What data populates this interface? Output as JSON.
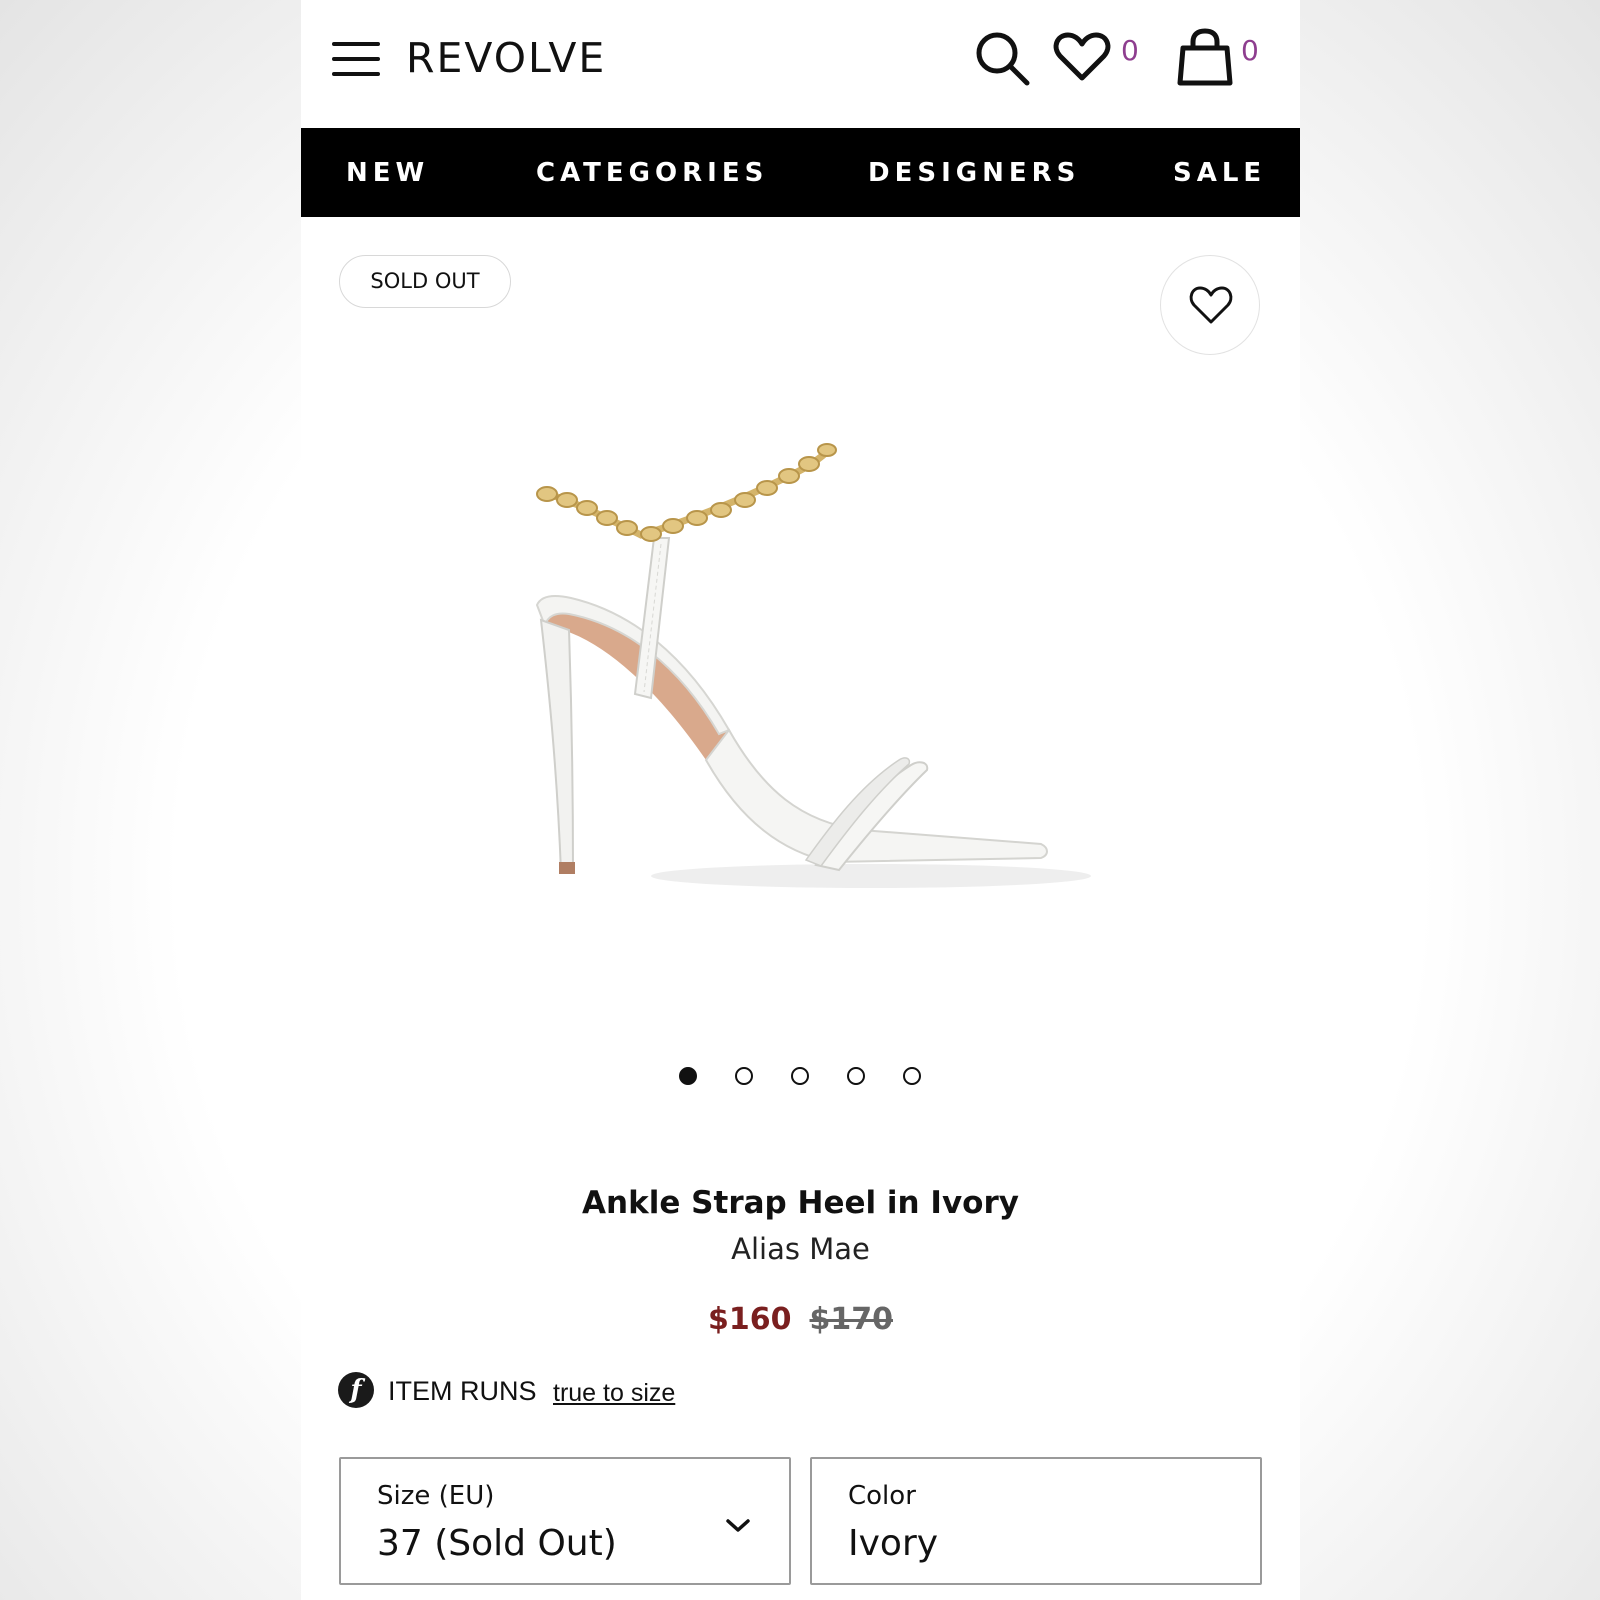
{
  "header": {
    "logo": "REVOLVE",
    "wishlist_count": "0",
    "cart_count": "0",
    "accent_color": "#8e3e8f"
  },
  "nav": {
    "items": [
      "NEW",
      "CATEGORIES",
      "DESIGNERS",
      "SALE"
    ]
  },
  "product": {
    "badge": "SOLD OUT",
    "title": "Ankle Strap Heel in Ivory",
    "brand": "Alias Mae",
    "price_sale": "$160",
    "price_original": "$170",
    "sale_color": "#7a1f1f",
    "image_count": 5,
    "active_image": 1,
    "fit": {
      "label": "ITEM RUNS",
      "value": "true to size",
      "icon": "f"
    },
    "size_select": {
      "label": "Size (EU)",
      "value": "37 (Sold Out)"
    },
    "color_select": {
      "label": "Color",
      "value": "Ivory"
    }
  }
}
